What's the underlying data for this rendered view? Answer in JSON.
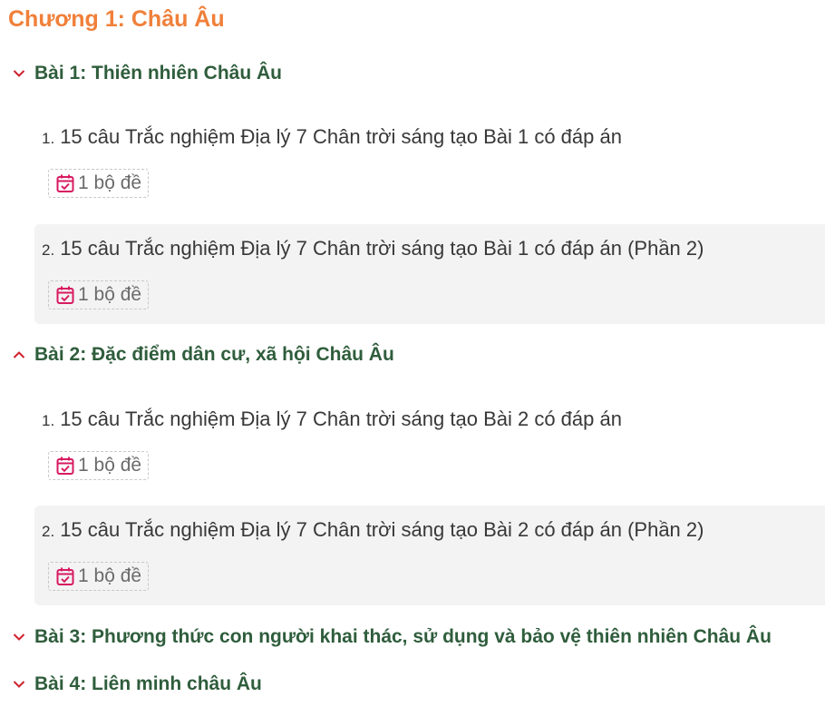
{
  "chapter": {
    "title": "Chương 1: Châu Âu"
  },
  "lessons": [
    {
      "title": "Bài 1: Thiên nhiên Châu Âu",
      "expanded": true,
      "items": [
        {
          "number": "1.",
          "title": "15 câu Trắc nghiệm Địa lý 7 Chân trời sáng tạo Bài 1 có đáp án",
          "badge": "1 bộ đề"
        },
        {
          "number": "2.",
          "title": "15 câu Trắc nghiệm Địa lý 7 Chân trời sáng tạo Bài 1 có đáp án (Phần 2)",
          "badge": "1 bộ đề"
        }
      ]
    },
    {
      "title": "Bài 2: Đặc điểm dân cư, xã hội Châu Âu",
      "expanded": true,
      "items": [
        {
          "number": "1.",
          "title": "15 câu Trắc nghiệm Địa lý 7 Chân trời sáng tạo Bài 2 có đáp án",
          "badge": "1 bộ đề"
        },
        {
          "number": "2.",
          "title": "15 câu Trắc nghiệm Địa lý 7 Chân trời sáng tạo Bài 2 có đáp án (Phần 2)",
          "badge": "1 bộ đề"
        }
      ]
    },
    {
      "title": "Bài 3: Phương thức con người khai thác, sử dụng và bảo vệ thiên nhiên Châu Âu",
      "expanded": false
    },
    {
      "title": "Bài 4: Liên minh châu Âu",
      "expanded": false
    }
  ],
  "colors": {
    "chapter_title": "#f0803a",
    "lesson_title": "#2f5d3c",
    "chevron": "#d0202e",
    "calendar_icon": "#d81b60",
    "item_shade": "#f3f3f3"
  },
  "icons": {
    "collapsed": "chevron-down-icon",
    "expanded": "chevron-up-icon",
    "badge": "calendar-check-icon"
  }
}
